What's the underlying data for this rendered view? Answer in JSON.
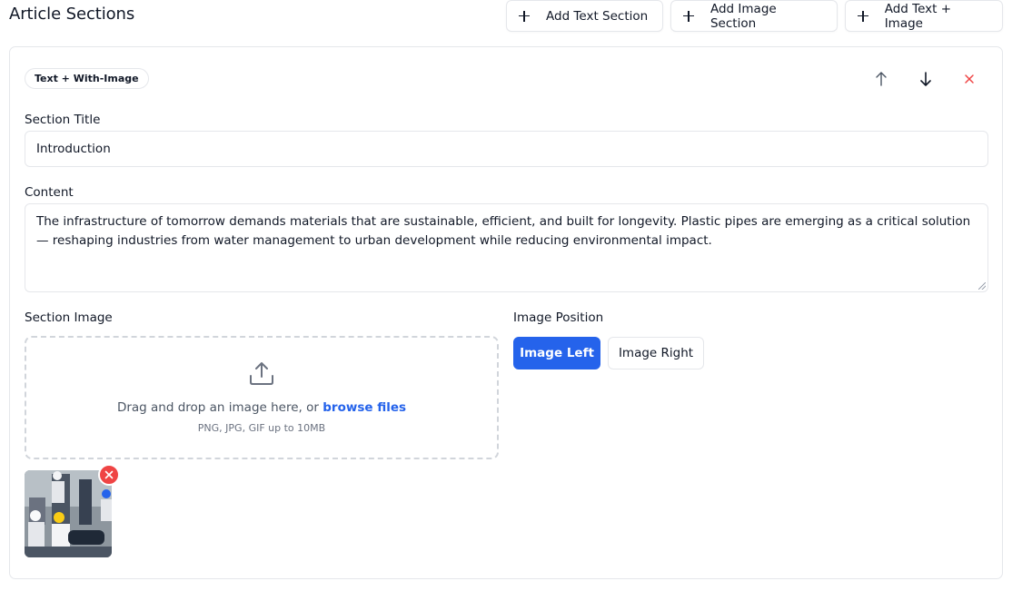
{
  "header": {
    "title": "Article Sections",
    "add_text_label": "Add Text Section",
    "add_image_label": "Add Image Section",
    "add_text_image_label": "Add Text + Image"
  },
  "section": {
    "type_badge": "Text + With-Image",
    "title_label": "Section Title",
    "title_value": "Introduction",
    "content_label": "Content",
    "content_value": "The infrastructure of tomorrow demands materials that are sustainable, efficient, and built for longevity. Plastic pipes are emerging as a critical solution — reshaping industries from water management to urban development while reducing environmental impact.",
    "image_label": "Section Image",
    "dropzone_text": "Drag and drop an image here, or",
    "dropzone_link": "browse files",
    "dropzone_hint": "PNG, JPG, GIF up to 10MB",
    "position_label": "Image Position",
    "position_options": [
      "Image Left",
      "Image Right"
    ],
    "position_selected": "Image Left"
  },
  "icons": {
    "plus": "plus-icon",
    "move_up": "arrow-up-icon",
    "move_down": "arrow-down-icon",
    "remove": "close-icon",
    "upload": "upload-icon",
    "thumbnail_remove": "close-icon"
  },
  "colors": {
    "accent": "#2563eb",
    "danger": "#ef4444",
    "border": "#e5e7eb"
  }
}
